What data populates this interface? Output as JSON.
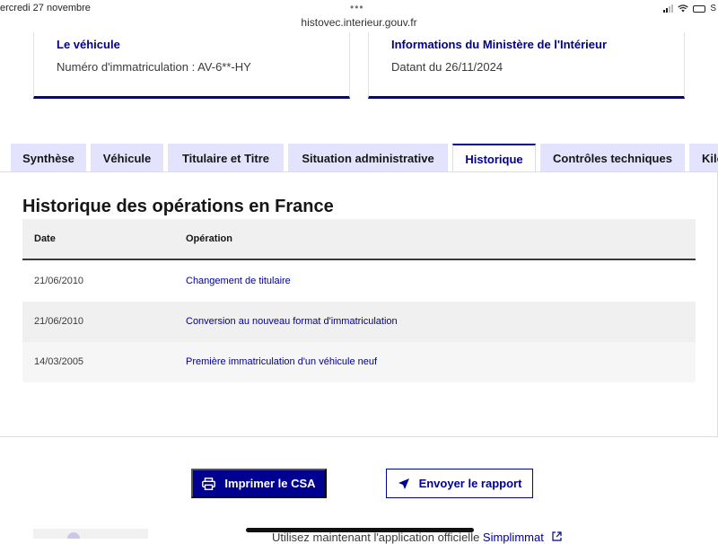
{
  "status_bar": {
    "date": "ercredi 27 novembre",
    "dots": "•••",
    "url": "histovec.interieur.gouv.fr",
    "battery_label": "S"
  },
  "cards": [
    {
      "title": "Le véhicule",
      "text": "Numéro d'immatriculation : AV-6**-HY"
    },
    {
      "title": "Informations du Ministère de l'Intérieur",
      "text": "Datant du 26/11/2024"
    }
  ],
  "tabs": [
    {
      "label": "Synthèse",
      "active": false
    },
    {
      "label": "Véhicule",
      "active": false
    },
    {
      "label": "Titulaire et Titre",
      "active": false
    },
    {
      "label": "Situation administrative",
      "active": false
    },
    {
      "label": "Historique",
      "active": true
    },
    {
      "label": "Contrôles techniques",
      "active": false
    },
    {
      "label": "Kilo",
      "active": false
    }
  ],
  "history": {
    "title": "Historique des opérations en France",
    "headers": {
      "date": "Date",
      "operation": "Opération"
    },
    "rows": [
      {
        "date": "21/06/2010",
        "operation": "Changement de titulaire"
      },
      {
        "date": "21/06/2010",
        "operation": "Conversion au nouveau format d'immatriculation"
      },
      {
        "date": "14/03/2005",
        "operation": "Première immatriculation d'un véhicule neuf"
      }
    ]
  },
  "actions": {
    "print_label": "Imprimer le CSA",
    "send_label": "Envoyer le rapport"
  },
  "footer": {
    "text": "Utilisez maintenant l'application officielle ",
    "link": "Simplimmat"
  },
  "colors": {
    "primary": "#000091",
    "tab_background": "#e3e3fd",
    "row_alt": "#f0f0f0"
  },
  "icons": [
    "printer-icon",
    "send-icon",
    "external-link-icon",
    "signal-icon",
    "wifi-icon",
    "battery-icon"
  ]
}
